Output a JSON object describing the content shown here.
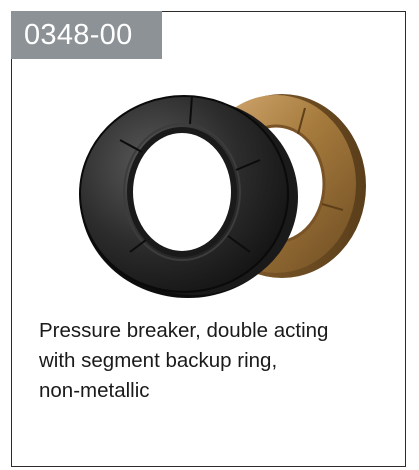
{
  "card": {
    "code": "0348-00",
    "description_lines": [
      "Pressure breaker, double acting",
      "with segment backup ring,",
      "non-metallic"
    ]
  },
  "image": {
    "icon": "pressure-breaker-seal-rings",
    "colors": {
      "black_ring": "#2a2a2a",
      "bronze_ring": "#a67b3d",
      "code_tab": "#8c9296"
    }
  }
}
